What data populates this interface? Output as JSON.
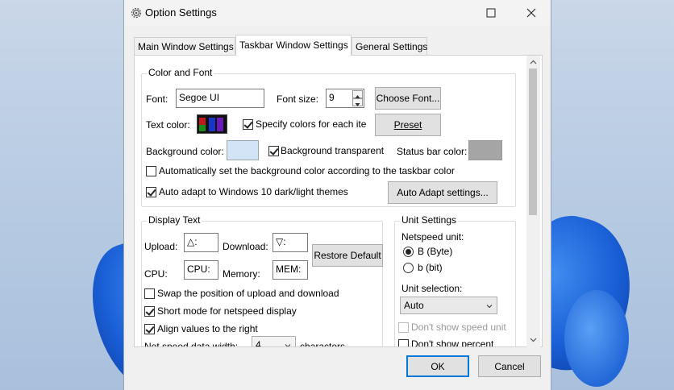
{
  "window": {
    "title": "Option Settings"
  },
  "tabs": [
    {
      "label": "Main Window Settings"
    },
    {
      "label": "Taskbar Window Settings"
    },
    {
      "label": "General Settings"
    }
  ],
  "color_font": {
    "group_title": "Color and Font",
    "font_label": "Font:",
    "font_value": "Segoe UI",
    "font_size_label": "Font size:",
    "font_size_value": "9",
    "choose_font_button": "Choose Font...",
    "text_color_label": "Text color:",
    "text_color_swatches": [
      "#c21a1a",
      "#1a8a1a",
      "#1a35c8",
      "#6a1ab8"
    ],
    "specify_colors_label": "Specify colors for each ite",
    "specify_colors_checked": true,
    "preset_button": "Preset",
    "background_color_label": "Background color:",
    "background_color_swatch": "#d4e4f7",
    "background_transparent_label": "Background transparent",
    "background_transparent_checked": true,
    "status_bar_color_label": "Status bar color:",
    "status_bar_color_swatch": "#a5a5a5",
    "auto_bg_label": "Automatically set the background color according to the taskbar color",
    "auto_bg_checked": false,
    "auto_adapt_label": "Auto adapt to Windows 10 dark/light themes",
    "auto_adapt_checked": true,
    "auto_adapt_button": "Auto Adapt settings..."
  },
  "display_text": {
    "group_title": "Display Text",
    "upload_label": "Upload:",
    "upload_value": "△:",
    "download_label": "Download:",
    "download_value": "▽:",
    "restore_default_button": "Restore Default",
    "cpu_label": "CPU:",
    "cpu_value": "CPU:",
    "memory_label": "Memory:",
    "memory_value": "MEM:",
    "swap_label": "Swap the position of upload and download",
    "swap_checked": false,
    "short_mode_label": "Short mode for netspeed display",
    "short_mode_checked": true,
    "align_right_label": "Align values to the right",
    "align_right_checked": true,
    "net_speed_width_label": "Net speed data width:",
    "net_speed_width_value": "4",
    "characters_label": "characters"
  },
  "unit_settings": {
    "group_title": "Unit Settings",
    "netspeed_unit_label": "Netspeed unit:",
    "unit_byte_label": "B (Byte)",
    "unit_byte_selected": true,
    "unit_bit_label": "b (bit)",
    "unit_bit_selected": false,
    "unit_selection_label": "Unit selection:",
    "unit_selection_value": "Auto",
    "dont_show_unit_label": "Don't show speed unit",
    "dont_show_unit_checked": false,
    "dont_show_percent_label": "Don't show percent",
    "dont_show_percent_checked": false
  },
  "footer": {
    "ok_button": "OK",
    "cancel_button": "Cancel"
  }
}
